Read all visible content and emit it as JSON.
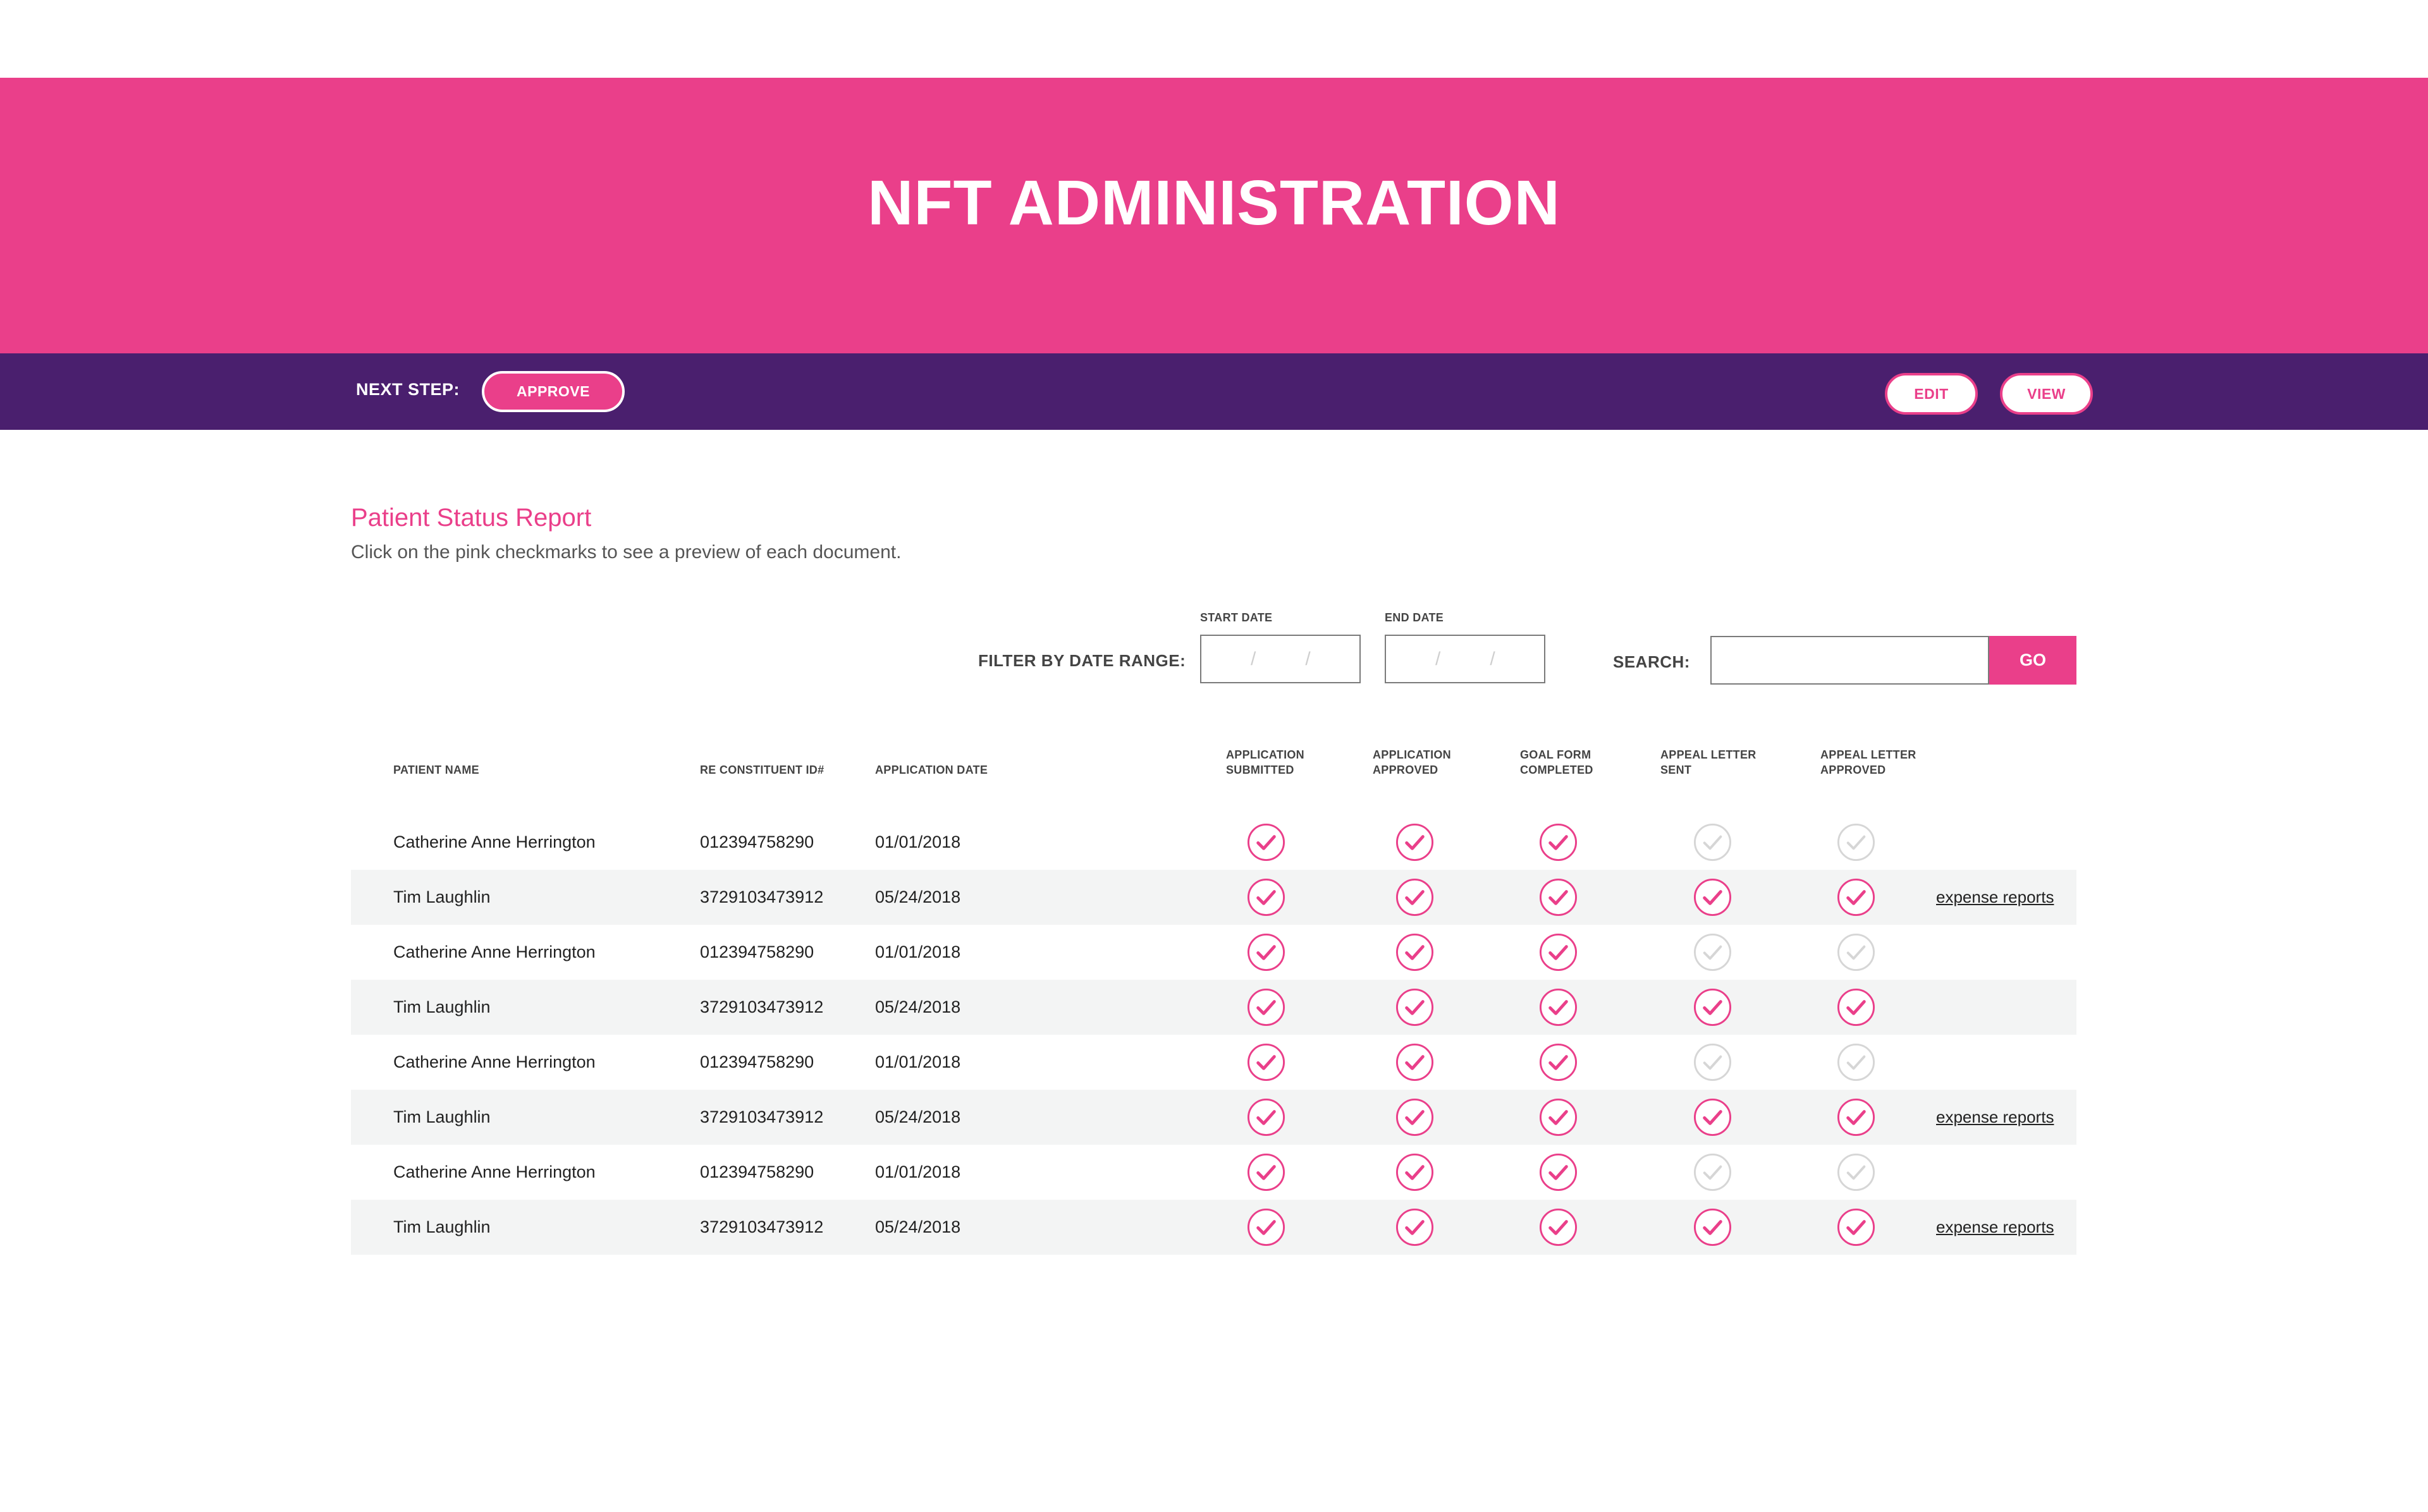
{
  "header": {
    "title": "NFT ADMINISTRATION"
  },
  "step_bar": {
    "next_step_label": "NEXT STEP:",
    "approve_label": "APPROVE",
    "edit_label": "EDIT",
    "view_label": "VIEW"
  },
  "report": {
    "title": "Patient Status Report",
    "subtitle": "Click on the pink checkmarks to see a preview of each document."
  },
  "filter": {
    "label": "FILTER BY DATE RANGE:",
    "start_date_label": "START DATE",
    "end_date_label": "END DATE",
    "date_separator": "/",
    "search_label": "SEARCH:",
    "search_value": "",
    "go_label": "GO"
  },
  "table": {
    "columns": {
      "patient_name": "PATIENT NAME",
      "constituent_id": "RE CONSTITUENT ID#",
      "application_date": "APPLICATION DATE",
      "app_submitted": [
        "APPLICATION",
        "SUBMITTED"
      ],
      "app_approved": [
        "APPLICATION",
        "APPROVED"
      ],
      "goal_form": [
        "GOAL FORM",
        "COMPLETED"
      ],
      "appeal_sent": [
        "APPEAL LETTER",
        "SENT"
      ],
      "appeal_approved": [
        "APPEAL LETTER",
        "APPROVED"
      ]
    },
    "rows": [
      {
        "name": "Catherine Anne Herrington",
        "id": "012394758290",
        "date": "01/01/2018",
        "status": [
          true,
          true,
          true,
          false,
          false
        ],
        "link": ""
      },
      {
        "name": "Tim Laughlin",
        "id": "3729103473912",
        "date": "05/24/2018",
        "status": [
          true,
          true,
          true,
          true,
          true
        ],
        "link": "expense reports"
      },
      {
        "name": "Catherine Anne Herrington",
        "id": "012394758290",
        "date": "01/01/2018",
        "status": [
          true,
          true,
          true,
          false,
          false
        ],
        "link": ""
      },
      {
        "name": "Tim Laughlin",
        "id": "3729103473912",
        "date": "05/24/2018",
        "status": [
          true,
          true,
          true,
          true,
          true
        ],
        "link": ""
      },
      {
        "name": "Catherine Anne Herrington",
        "id": "012394758290",
        "date": "01/01/2018",
        "status": [
          true,
          true,
          true,
          false,
          false
        ],
        "link": ""
      },
      {
        "name": "Tim Laughlin",
        "id": "3729103473912",
        "date": "05/24/2018",
        "status": [
          true,
          true,
          true,
          true,
          true
        ],
        "link": "expense reports"
      },
      {
        "name": "Catherine Anne Herrington",
        "id": "012394758290",
        "date": "01/01/2018",
        "status": [
          true,
          true,
          true,
          false,
          false
        ],
        "link": ""
      },
      {
        "name": "Tim Laughlin",
        "id": "3729103473912",
        "date": "05/24/2018",
        "status": [
          true,
          true,
          true,
          true,
          true
        ],
        "link": "expense reports"
      }
    ]
  },
  "icons": {
    "check_complete": "check-circle-icon",
    "check_pending": "check-circle-outline-icon"
  },
  "colors": {
    "brand_pink": "#ea3f8a",
    "brand_purple": "#4a1f6e",
    "pending_gray": "#d6d6d6",
    "row_shade": "#f3f4f4"
  }
}
